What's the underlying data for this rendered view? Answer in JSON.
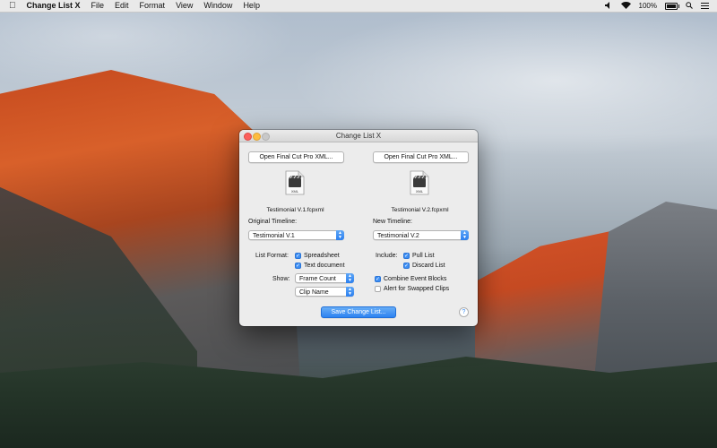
{
  "menubar": {
    "app_name": "Change List X",
    "menus": [
      "File",
      "Edit",
      "Format",
      "View",
      "Window",
      "Help"
    ],
    "battery": "100%"
  },
  "window": {
    "title": "Change List X",
    "left": {
      "open_button": "Open Final Cut Pro XML...",
      "file_name": "Testimonial V.1.fcpxml",
      "timeline_label": "Original Timeline:",
      "timeline_value": "Testimonial V.1"
    },
    "right": {
      "open_button": "Open Final Cut Pro XML...",
      "file_name": "Testimonial V.2.fcpxml",
      "timeline_label": "New Timeline:",
      "timeline_value": "Testimonial V.2"
    },
    "list_format": {
      "label": "List Format:",
      "spreadsheet": "Spreadsheet",
      "text_document": "Text document",
      "spreadsheet_checked": true,
      "text_document_checked": true
    },
    "show": {
      "label": "Show:",
      "first": "Frame Count",
      "second": "Clip Name"
    },
    "include": {
      "label": "Include:",
      "pull_list": "Pull List",
      "discard_list": "Discard List",
      "pull_list_checked": true,
      "discard_list_checked": true
    },
    "combine_event_blocks": "Combine Event Blocks",
    "combine_event_blocks_checked": true,
    "alert_swapped_clips": "Alert for Swapped Clips",
    "alert_swapped_clips_checked": false,
    "save_button": "Save Change List...",
    "help": "?",
    "xml_badge": "XML"
  },
  "colors": {
    "accent": "#3e8ff4",
    "close": "#fc605c",
    "minimize": "#fdbc40"
  }
}
